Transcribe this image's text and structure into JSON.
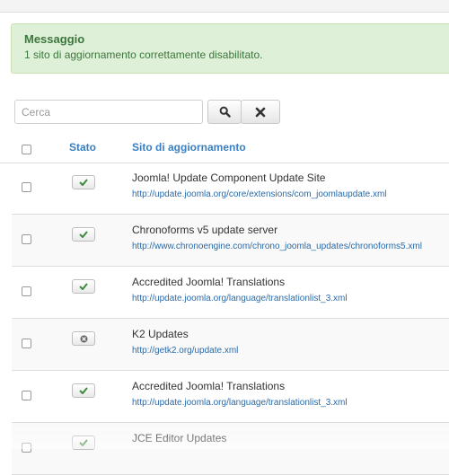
{
  "message": {
    "title": "Messaggio",
    "text": "1 sito di aggiornamento correttamente disabilitato."
  },
  "search": {
    "placeholder": "Cerca",
    "search_icon": "search-icon",
    "clear_icon": "close-icon"
  },
  "table": {
    "headers": {
      "status": "Stato",
      "site": "Sito di aggiornamento"
    },
    "rows": [
      {
        "name": "Joomla! Update Component Update Site",
        "url": "http://update.joomla.org/core/extensions/com_joomlaupdate.xml",
        "enabled": true
      },
      {
        "name": "Chronoforms v5 update server",
        "url": "http://www.chronoengine.com/chrono_joomla_updates/chronoforms5.xml",
        "enabled": true
      },
      {
        "name": "Accredited Joomla! Translations",
        "url": "http://update.joomla.org/language/translationlist_3.xml",
        "enabled": true
      },
      {
        "name": "K2 Updates",
        "url": "http://getk2.org/update.xml",
        "enabled": false
      },
      {
        "name": "Accredited Joomla! Translations",
        "url": "http://update.joomla.org/language/translationlist_3.xml",
        "enabled": true
      },
      {
        "name": "JCE Editor Updates",
        "url": "",
        "enabled": true
      }
    ]
  },
  "colors": {
    "success_bg": "#dff0d8",
    "success_text": "#3c763d",
    "link": "#2a6aa8",
    "header_link": "#3a7fc1",
    "check_green": "#3d8b3d"
  }
}
